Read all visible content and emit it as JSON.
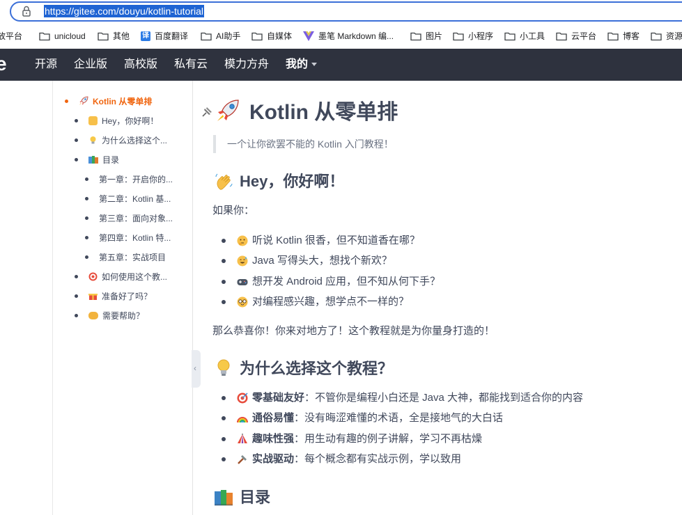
{
  "browser": {
    "url": "https://gitee.com/douyu/kotlin-tutorial",
    "bookmarks": [
      "放平台",
      "unicloud",
      "其他",
      "百度翻译",
      "AI助手",
      "自媒体",
      "墨笔 Markdown 编...",
      "图片",
      "小程序",
      "小工具",
      "云平台",
      "博客",
      "资源"
    ],
    "translate_badge": "译"
  },
  "nav": {
    "logo_fragment": "e",
    "items": [
      "开源",
      "企业版",
      "高校版",
      "私有云",
      "模力方舟",
      "我的"
    ]
  },
  "toc": {
    "items": [
      {
        "label": "Kotlin 从零单排",
        "icon": "rocket-icon"
      },
      {
        "label": "Hey，你好啊！",
        "icon": "waving-hand-icon"
      },
      {
        "label": "为什么选择这个...",
        "icon": "bulb-icon"
      },
      {
        "label": "目录",
        "icon": "books-icon"
      },
      {
        "label": "第一章：开启你的..."
      },
      {
        "label": "第二章：Kotlin 基..."
      },
      {
        "label": "第三章：面向对象..."
      },
      {
        "label": "第四章：Kotlin 特..."
      },
      {
        "label": "第五章：实战项目"
      },
      {
        "label": "如何使用这个教...",
        "icon": "target-icon"
      },
      {
        "label": "准备好了吗？",
        "icon": "gift-icon"
      },
      {
        "label": "需要帮助？",
        "icon": "handshake-icon"
      }
    ],
    "collapse_glyph": "‹"
  },
  "article": {
    "title": "Kotlin 从零单排",
    "subtitle": "一个让你欲罢不能的 Kotlin 入门教程！",
    "hello_heading": "Hey，你好啊！",
    "intro": "如果你：",
    "questions": [
      {
        "icon": "thinking-face-icon",
        "text": "听说 Kotlin 很香，但不知道香在哪？"
      },
      {
        "icon": "sweat-smile-icon",
        "text": "Java 写得头大，想找个新欢？"
      },
      {
        "icon": "gamepad-icon",
        "text": "想开发 Android 应用，但不知从何下手？"
      },
      {
        "icon": "nerd-face-icon",
        "text": "对编程感兴趣，想学点不一样的？"
      }
    ],
    "congrats": "那么恭喜你！你来对地方了！这个教程就是为你量身打造的！",
    "why_heading": "为什么选择这个教程？",
    "reasons": [
      {
        "icon": "target-icon",
        "bold": "零基础友好",
        "text": "：不管你是编程小白还是 Java 大神，都能找到适合你的内容"
      },
      {
        "icon": "rainbow-icon",
        "bold": "通俗易懂",
        "text": "：没有晦涩难懂的术语，全是接地气的大白话"
      },
      {
        "icon": "circus-tent-icon",
        "bold": "趣味性强",
        "text": "：用生动有趣的例子讲解，学习不再枯燥"
      },
      {
        "icon": "hammer-icon",
        "bold": "实战驱动",
        "text": "：每个概念都有实战示例，学以致用"
      }
    ],
    "toc_heading": "目录"
  },
  "colors": {
    "nav_bg": "#2e323e",
    "accent_orange": "#f0650f",
    "url_highlight": "#1f64d3",
    "text": "#40485b"
  }
}
